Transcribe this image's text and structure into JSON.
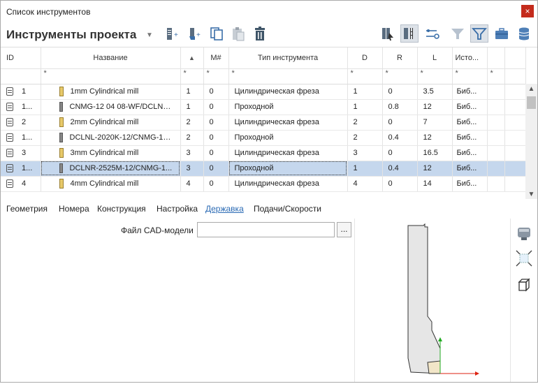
{
  "window": {
    "title": "Список инструментов",
    "close": "×"
  },
  "toolbar": {
    "heading": "Инструменты проекта"
  },
  "columns": [
    "ID",
    "Название",
    "M#",
    "Тип инструмента",
    "D",
    "R",
    "L",
    "Исто..."
  ],
  "filter_marker": "*",
  "rows": [
    {
      "id": "1",
      "name": "1mm Cylindrical mill",
      "n": "1",
      "m": "0",
      "type": "Цилиндрическая фреза",
      "d": "1",
      "r": "0",
      "l": "3.5",
      "src": "Биб...",
      "holder": false
    },
    {
      "id": "1...",
      "name": "CNMG-12 04 08-WF/DCLNR...",
      "n": "1",
      "m": "0",
      "type": "Проходной",
      "d": "1",
      "r": "0.8",
      "l": "12",
      "src": "Биб...",
      "holder": true
    },
    {
      "id": "2",
      "name": "2mm Cylindrical mill",
      "n": "2",
      "m": "0",
      "type": "Цилиндрическая фреза",
      "d": "2",
      "r": "0",
      "l": "7",
      "src": "Биб...",
      "holder": false
    },
    {
      "id": "1...",
      "name": "DCLNL-2020K-12/CNMG-12 ...",
      "n": "2",
      "m": "0",
      "type": "Проходной",
      "d": "2",
      "r": "0.4",
      "l": "12",
      "src": "Биб...",
      "holder": true
    },
    {
      "id": "3",
      "name": "3mm Cylindrical mill",
      "n": "3",
      "m": "0",
      "type": "Цилиндрическая фреза",
      "d": "3",
      "r": "0",
      "l": "16.5",
      "src": "Биб...",
      "holder": false
    },
    {
      "id": "1...",
      "name": "DCLNR-2525M-12/CNMG-1...",
      "n": "3",
      "m": "0",
      "type": "Проходной",
      "d": "1",
      "r": "0.4",
      "l": "12",
      "src": "Биб...",
      "holder": true,
      "selected": true
    },
    {
      "id": "4",
      "name": "4mm Cylindrical mill",
      "n": "4",
      "m": "0",
      "type": "Цилиндрическая фреза",
      "d": "4",
      "r": "0",
      "l": "14",
      "src": "Биб...",
      "holder": false
    }
  ],
  "tabs": [
    "Геометрия",
    "Номера",
    "Конструкция",
    "Настройка",
    "Державка",
    "Подачи/Скорости"
  ],
  "form": {
    "cad_label": "Файл CAD-модели",
    "cad_value": "",
    "browse": "..."
  },
  "colors": {
    "selection": "#c5d7ed",
    "tab_active": "#2a6ab4",
    "close": "#c42b1c"
  }
}
